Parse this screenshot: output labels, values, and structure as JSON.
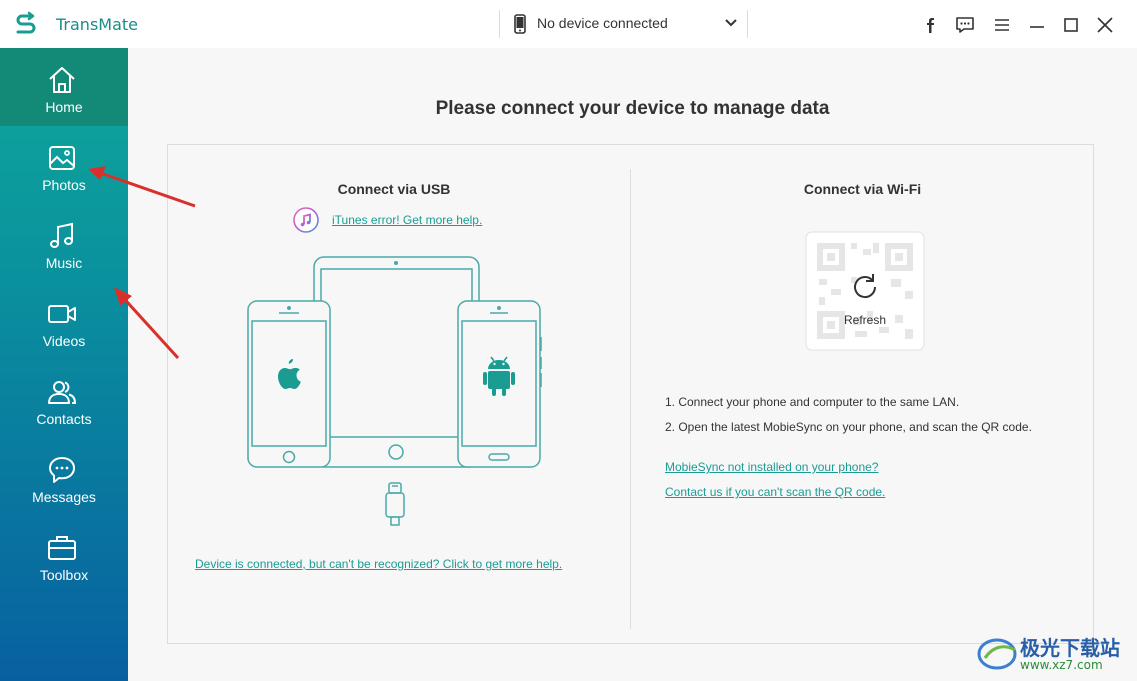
{
  "app": {
    "name": "TransMate"
  },
  "device_selector": {
    "label": "No device connected"
  },
  "sidebar": {
    "items": [
      {
        "label": "Home",
        "icon": "home-icon",
        "active": true
      },
      {
        "label": "Photos",
        "icon": "photo-icon",
        "active": false
      },
      {
        "label": "Music",
        "icon": "music-icon",
        "active": false
      },
      {
        "label": "Videos",
        "icon": "video-icon",
        "active": false
      },
      {
        "label": "Contacts",
        "icon": "contacts-icon",
        "active": false
      },
      {
        "label": "Messages",
        "icon": "message-icon",
        "active": false
      },
      {
        "label": "Toolbox",
        "icon": "toolbox-icon",
        "active": false
      }
    ]
  },
  "main": {
    "title": "Please connect your device to manage data",
    "usb": {
      "title": "Connect via USB",
      "itunes_link": "iTunes error! Get more help.",
      "help_link": "Device is connected, but can't be recognized? Click to get more help."
    },
    "wifi": {
      "title": "Connect via Wi-Fi",
      "refresh_label": "Refresh",
      "instructions": [
        "1. Connect your phone and computer to the same LAN.",
        "2. Open the latest MobieSync on your phone, and scan the QR code."
      ],
      "links": [
        "MobieSync not installed on your phone?",
        "Contact us if you can't scan the QR code."
      ]
    }
  },
  "watermark": {
    "text": "极光下载站",
    "url": "www.xz7.com"
  },
  "colors": {
    "accent": "#1a9c93",
    "sidebar_top": "#0fa89a",
    "sidebar_bottom": "#0860a0",
    "arrow": "#d9302c"
  }
}
